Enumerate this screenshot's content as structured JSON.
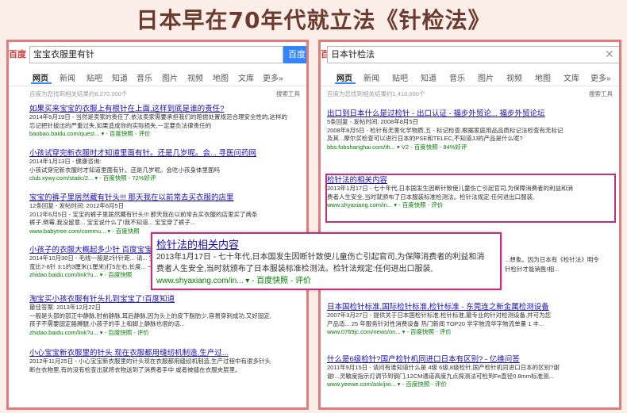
{
  "headline": "日本早在70年代就立法《针检法》",
  "left": {
    "logo": "百度",
    "query": "宝宝衣服里有针",
    "button": "百度一",
    "tabs": [
      "网页",
      "新闻",
      "贴吧",
      "知道",
      "音乐",
      "图片",
      "视频",
      "地图",
      "文库",
      "更多»"
    ],
    "stat": "百度为您找到相关结果约8,270,000个",
    "tools": "搜索工具",
    "results": [
      {
        "t1": "如果买来宝宝的衣服上有根针在上面,这样到底是谁的责任?",
        "d1": "2014年5月19日 - 当然是卖家的责任了,依法卖家需要承担我们的赔偿处置规范合理安全性的,这样的",
        "d2": "忘记把针拔出的严重过失,如果造成你的实际损失,一定要负法律责任的",
        "url": "baobao.baidu.com/quest... ▾ - 百度快照 - 评价"
      },
      {
        "t1": "小孩试穿完新衣服时才知道里面有针。还是几岁呢。会... 寻医问药网",
        "d1": "2014年1月13日 - 健康咨询:",
        "d2": "小孩试穿完新衣服时才知道里面有针。还是几岁呢。会吃小孩身体里面吗",
        "url": "club.xywy.com/static/2... ▾ - 百度快照 - 72%好评"
      },
      {
        "t1": "宝宝的裤子里居然藏有针头!!! 那天我在以前常去买衣服的店里",
        "d1": "12条回复 - 发帖时间: 2012年6月5日",
        "d2": "2012年6月5日 - 宝宝的裤子里居然藏有针头!!! 那天我在以前常去买衣服的店里买了两条",
        "d3": "裤子,倒霉,我没留意... 宝宝说什么了!我不知道... 宝宝穿了裤子...",
        "url": "www.babytree.com/commu... ▾ - 百度快照"
      },
      {
        "t1": "小孩子的衣服大概起多少针 百度宝宝知道",
        "d1": "2014年10月30日 - 毛线一般是2针针距... 请... 宝宝不停... 是这",
        "d2": "宽比7-8针 3:1的3厘米(1厘米)打5左右,长度... 一",
        "url": "zhidao.baidu.com/link?u... ▾ - 百度快照"
      },
      {
        "t1": "淘宝买小孩衣服有针头扎到宝宝了!百度知道",
        "d1": "最佳答案: 2013年12月22日",
        "d2": "一般是头部的部正中静脉,肘前静脉,耳后静脉,因为头上的皮下脂肪少,容易穿刺成功,又好固定,",
        "d3": "孩子不需要固定胳膊腿,小孩子的手上和脚上静脉也很的话...",
        "url": "zhidao.baidu.com/link?u... ▾ - 百度快照 - 评价"
      },
      {
        "t1": "小心宝宝新衣服里的针头 现在衣服都用缝纫机制造,生产过...",
        "d1": "2012年11月25日 - 小心宝宝新衣服里的针头现在衣服都用缝纫机制造,生产过程中有很多针头",
        "d2": "断在衣物里,有的没有检查出就将衣物送到了消费者手中 或者被缝在衣服夹层里。",
        "url": ""
      }
    ]
  },
  "right": {
    "query": "日本针检法",
    "button": "百度一",
    "tabs": [
      "网页",
      "新闻",
      "贴吧",
      "知道",
      "音乐",
      "图片",
      "视频",
      "地图",
      "文库",
      "更多»"
    ],
    "stat": "百度为您找到相关结果约1,410,000个",
    "tools": "搜索工具",
    "results": [
      {
        "t1": "出口到日本什么是过检针 - 出口认证 - 福步外贸论... 福步外贸论坛",
        "d1": "5条回复 - 发帖时间: 2008年8月5日",
        "d2": "2008年8月5日 - 检针有无害化学物质,五 - 标记检查,根据家庭用品品质标记法检查有无标记",
        "d3": "及其...摩尔买检查可以进行日本的PSE和TELEC,不知道JJ的产品是什么呢?",
        "url": "bbs.fobshanghai.com/th... ▾ V2 - 百度快照 - 84%好评"
      },
      {
        "t1": "检针法的相关内容",
        "d1": "2013年1月17日 - 七十年代,日本国发生因断针致使儿童伤亡引起官司,为保障消费者的利益和消",
        "d2": "费者人生安全,当时就颁布了日本服装标准检测法。检针法规定:任何进出口服装,",
        "url": "www.shyaxiang.com/in... ▾ - 百度快照 - 评价"
      },
      {
        "t1": "",
        "d1": "",
        "d2": "",
        "url": "                                                 ...想象。因为日本有《检针法》明令",
        "u2": "                                                 针检针才能销售!相..."
      },
      {
        "t1": "日本国检针标准,国际检针标准,检针标准 - 东莞连之新金属检测设备",
        "d1": "2007年3月27日 - 提供关于日本国检针标准,检针标准,最专业的针对检测设备,并可为您",
        "d2": "产品适... 25 年服务针对性消费设备 热门新闻 TOP20 学字物流华字物流单量 1 丰...",
        "url": "www.0769jc.com/news/on... ▾ - 百度快照 - 评价"
      },
      {
        "t1": "什么是6级检针?国产检针机同进口日本有区别? - 亿维问答",
        "d1": "2011年9月15日 - 请问有谁知道什么是 4级 6级,8级检针,国产检针机同进口日本的区别?谢",
        "d2": "谢!...灵敏度指示灯调节到钢门,12CM通道高度九点探测法可检到Fe直径0.8mm标准测...",
        "url": "www.yeewe.com/ask/jixi... ▾ - 百度快照 - 评价"
      }
    ]
  },
  "callout": {
    "title": "检针法的相关内容",
    "d1": "2013年1月17日 - 七十年代,日本国发生因断针致使儿童伤亡引起官司,为保障消费者的利益和消",
    "d2": "费者人生安全,当时就颁布了日本服装标准检测法。检针法规定:任何进出口服装,",
    "url": "www.shyaxiang.com/in... ▾ - 百度快照 - 评价"
  },
  "colors": {
    "accent": "#3385ff",
    "frame": "#e07c7c",
    "highlight": "#c0307a",
    "link": "#1a0dab",
    "keyword": "#cc0000",
    "url": "#008000"
  }
}
